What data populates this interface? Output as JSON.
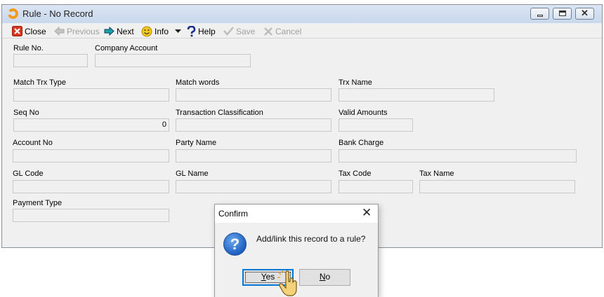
{
  "window": {
    "title": "Rule - No Record",
    "controls": {
      "minimize": "minimize-icon",
      "maximize": "maximize-icon",
      "close": "close-icon"
    }
  },
  "toolbar": {
    "close": "Close",
    "previous": "Previous",
    "next": "Next",
    "info": "Info",
    "help": "Help",
    "save": "Save",
    "cancel": "Cancel"
  },
  "form": {
    "rule_no": {
      "label": "Rule No.",
      "value": ""
    },
    "company_account": {
      "label": "Company Account",
      "value": ""
    },
    "match_trx_type": {
      "label": "Match Trx Type",
      "value": ""
    },
    "match_words": {
      "label": "Match words",
      "value": ""
    },
    "trx_name": {
      "label": "Trx Name",
      "value": ""
    },
    "seq_no": {
      "label": "Seq No",
      "value": "0"
    },
    "transaction_classification": {
      "label": "Transaction Classification",
      "value": ""
    },
    "valid_amounts": {
      "label": "Valid Amounts",
      "value": ""
    },
    "account_no": {
      "label": "Account No",
      "value": ""
    },
    "party_name": {
      "label": "Party Name",
      "value": ""
    },
    "bank_charge": {
      "label": "Bank Charge",
      "value": ""
    },
    "gl_code": {
      "label": "GL Code",
      "value": ""
    },
    "gl_name": {
      "label": "GL Name",
      "value": ""
    },
    "tax_code": {
      "label": "Tax Code",
      "value": ""
    },
    "tax_name": {
      "label": "Tax Name",
      "value": ""
    },
    "payment_type": {
      "label": "Payment Type",
      "value": ""
    }
  },
  "dialog": {
    "title": "Confirm",
    "message": "Add/link this record to a rule?",
    "icon": "question-icon",
    "yes_mnemonic": "Y",
    "yes_rest": "es",
    "no_mnemonic": "N",
    "no_rest": "o"
  },
  "colors": {
    "window_bg": "#f0f0f0",
    "titlebar": "#c9d8ec",
    "close_red": "#d9341e",
    "next_teal": "#1aa3a3",
    "info_yellow": "#f3c81f",
    "help_blue": "#1a2f8a",
    "dialog_accent": "#0078d7"
  }
}
